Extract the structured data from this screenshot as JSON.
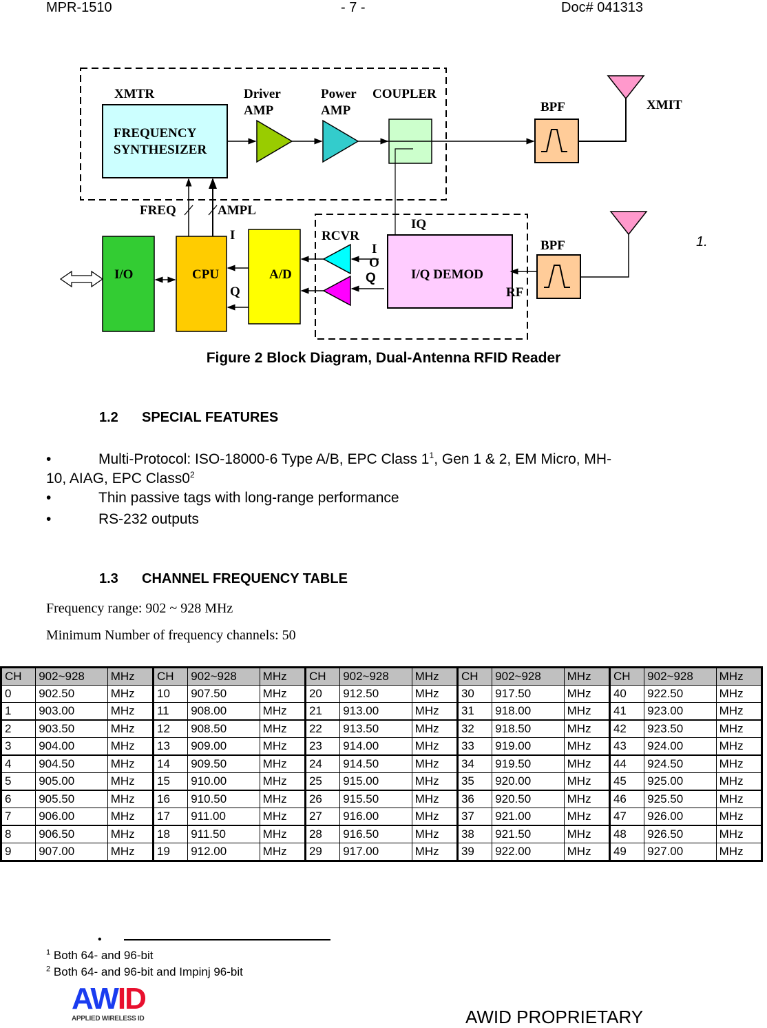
{
  "header": {
    "left": "MPR-1510",
    "center": "- 7 -",
    "right": "Doc# 041313"
  },
  "diagram": {
    "labels": {
      "xmtr": "XMTR",
      "freq_synth_1": "FREQUENCY",
      "freq_synth_2": "SYNTHESIZER",
      "driver_1": "Driver",
      "driver_2": "AMP",
      "power_1": "Power",
      "power_2": "AMP",
      "coupler": "COUPLER",
      "bpf_top": "BPF",
      "xmit": "XMIT",
      "freq": "FREQ",
      "ampl": "AMPL",
      "io": "I/O",
      "cpu": "CPU",
      "ad": "A/D",
      "i_cpu": "I",
      "q_cpu": "Q",
      "rcvr": "RCVR",
      "iq": "IQ",
      "i_rcvr": "I",
      "o_rcvr": "O",
      "q_rcvr": "Q",
      "iq_demod": "I/Q DEMOD",
      "rf": "RF",
      "bpf_bottom": "BPF",
      "note": "1."
    },
    "colors": {
      "freq_synth": "#ccffff",
      "driver_amp": "#99cc00",
      "power_amp": "#33cccc",
      "coupler": "#ccffcc",
      "bpf": "#ffcc99",
      "antenna": "#ff99cc",
      "io": "#33cc33",
      "cpu": "#ffcc00",
      "ad": "#ffff00",
      "rcvr_i": "#00ffff",
      "rcvr_q": "#ff00ff",
      "iq_demod": "#ffccff"
    }
  },
  "figure_caption": "Figure 2 Block Diagram, Dual-Antenna RFID Reader",
  "section_1_2": {
    "number": "1.2",
    "title": "SPECIAL FEATURES",
    "bullets": [
      {
        "text_a": "Multi-Protocol: ISO-18000-6 Type A/B, EPC Class 1",
        "sup_a": "1",
        "text_b": ", Gen 1 & 2, EM Micro, MH-",
        "text_c": "10, AIAG, EPC Class0",
        "sup_c": "2"
      },
      {
        "text": "Thin passive tags with long-range performance"
      },
      {
        "text": "RS-232 outputs"
      }
    ],
    "bullet_glyph": "•"
  },
  "section_1_3": {
    "number": "1.3",
    "title": "CHANNEL FREQUENCY TABLE",
    "freq_range": "Frequency range: 902 ~ 928 MHz",
    "min_channels": "Minimum Number of frequency channels: 50"
  },
  "table": {
    "header": [
      "CH",
      "902~928",
      "MHz"
    ],
    "unit": "MHz",
    "groups": [
      {
        "ch": [
          "0",
          "1",
          "2",
          "3",
          "4",
          "5",
          "6",
          "7",
          "8",
          "9"
        ],
        "freq": [
          "902.50",
          "903.00",
          "903.50",
          "904.00",
          "904.50",
          "905.00",
          "905.50",
          "906.00",
          "906.50",
          "907.00"
        ]
      },
      {
        "ch": [
          "10",
          "11",
          "12",
          "13",
          "14",
          "15",
          "16",
          "17",
          "18",
          "19"
        ],
        "freq": [
          "907.50",
          "908.00",
          "908.50",
          "909.00",
          "909.50",
          "910.00",
          "910.50",
          "911.00",
          "911.50",
          "912.00"
        ]
      },
      {
        "ch": [
          "20",
          "21",
          "22",
          "23",
          "24",
          "25",
          "26",
          "27",
          "28",
          "29"
        ],
        "freq": [
          "912.50",
          "913.00",
          "913.50",
          "914.00",
          "914.50",
          "915.00",
          "915.50",
          "916.00",
          "916.50",
          "917.00"
        ]
      },
      {
        "ch": [
          "30",
          "31",
          "32",
          "33",
          "34",
          "35",
          "36",
          "37",
          "38",
          "39"
        ],
        "freq": [
          "917.50",
          "918.00",
          "918.50",
          "919.00",
          "919.50",
          "920.00",
          "920.50",
          "921.00",
          "921.50",
          "922.00"
        ]
      },
      {
        "ch": [
          "40",
          "41",
          "42",
          "43",
          "44",
          "45",
          "46",
          "47",
          "48",
          "49"
        ],
        "freq": [
          "922.50",
          "923.00",
          "923.50",
          "924.00",
          "924.50",
          "925.00",
          "925.50",
          "926.00",
          "926.50",
          "927.00"
        ]
      }
    ]
  },
  "footnotes": [
    {
      "mark": "1",
      "text": "Both 64- and 96-bit"
    },
    {
      "mark": "2",
      "text": "Both 64- and 96-bit and Impinj 96-bit"
    }
  ],
  "footer": {
    "logo_text": "AWID",
    "logo_sub": "APPLIED WIRELESS ID",
    "proprietary": "AWID PROPRIETARY"
  }
}
